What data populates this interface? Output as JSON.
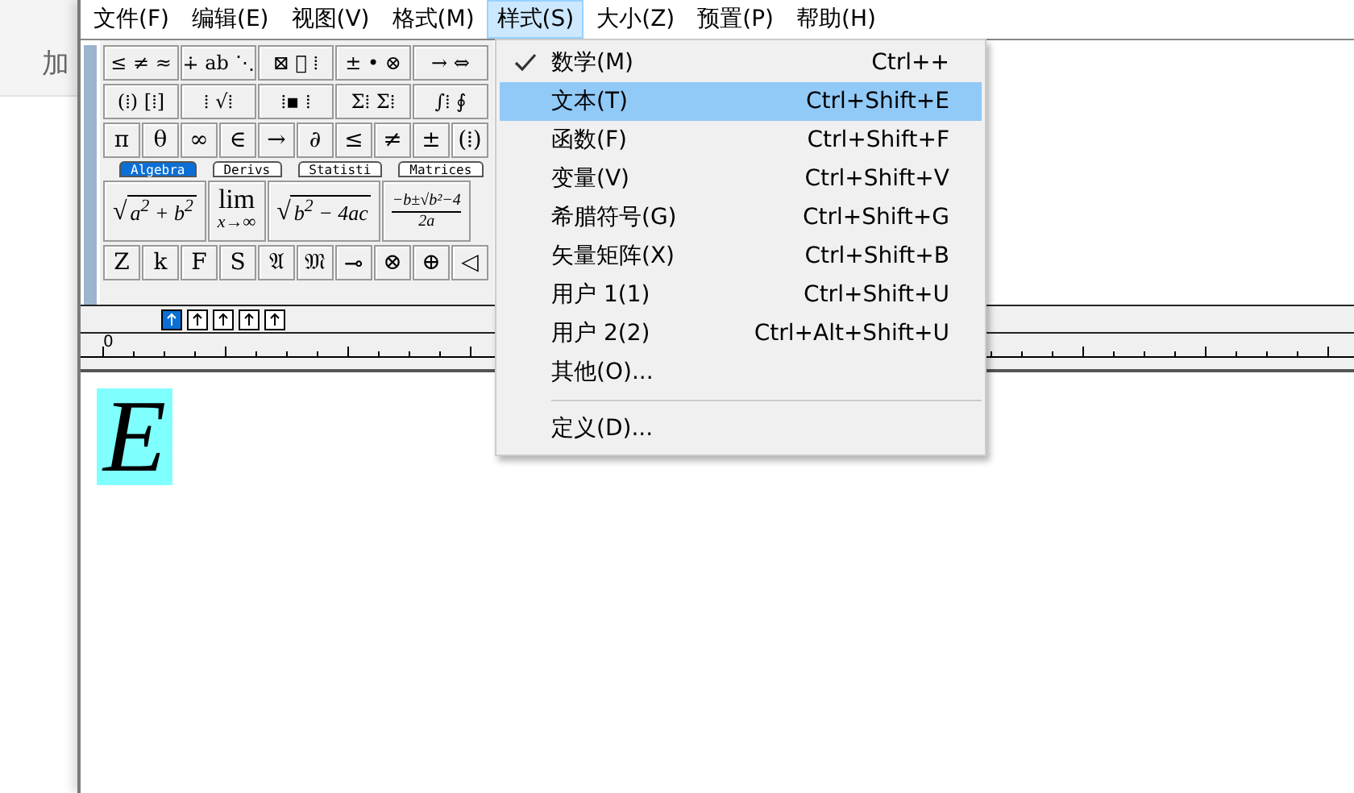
{
  "background_window": {
    "label": "加"
  },
  "menu_bar": [
    {
      "label": "文件(F)",
      "selected": false
    },
    {
      "label": "编辑(E)",
      "selected": false
    },
    {
      "label": "视图(V)",
      "selected": false
    },
    {
      "label": "格式(M)",
      "selected": false
    },
    {
      "label": "样式(S)",
      "selected": true
    },
    {
      "label": "大小(Z)",
      "selected": false
    },
    {
      "label": "预置(P)",
      "selected": false
    },
    {
      "label": "帮助(H)",
      "selected": false
    }
  ],
  "symbol_palettes": [
    [
      "≤ ≠ ≈",
      "∔ ab ⋱",
      "⊠ ⃗ ⁞",
      "± • ⊗",
      "→ ⇔"
    ],
    [
      "(⁞) [⁞]",
      "⁞ √⁞",
      "⁞▪ ⁞",
      "Σ⁞ Σ⁞",
      "∫⁞ ∮"
    ]
  ],
  "symbols": [
    "π",
    "θ",
    "∞",
    "∈",
    "→",
    "∂",
    "≤",
    "≠",
    "±",
    "(⁞)"
  ],
  "tabs": [
    {
      "label": "Algebra",
      "selected": true
    },
    {
      "label": "Derivs",
      "selected": false
    },
    {
      "label": "Statisti",
      "selected": false
    },
    {
      "label": "Matrices",
      "selected": false
    }
  ],
  "templates": [
    {
      "kind": "sqrt",
      "radical": "√",
      "body": "a$^{2}$ + b$^{2}$"
    },
    {
      "kind": "limit",
      "top": "lim",
      "bottom": "x→∞"
    },
    {
      "kind": "sqrt",
      "radical": "√",
      "body": "b$^{2}$ − 4ac"
    },
    {
      "kind": "fraction",
      "numerator": "−b±√b²−4",
      "denominator": "2a"
    }
  ],
  "style_symbols": [
    "Z",
    "k",
    "F",
    "S",
    "𝔄",
    "𝔐",
    "⊸",
    "⊗",
    "⊕",
    "◁"
  ],
  "nudge_buttons": [
    {
      "selected": true
    },
    {
      "selected": false
    },
    {
      "selected": false
    },
    {
      "selected": false
    },
    {
      "selected": false
    }
  ],
  "ruler": {
    "origin": "0"
  },
  "equation": {
    "text": "E",
    "selected": true
  },
  "style_menu": [
    {
      "kind": "item",
      "label": "数学(M)",
      "shortcut": "Ctrl++",
      "checked": true,
      "selected": false
    },
    {
      "kind": "item",
      "label": "文本(T)",
      "shortcut": "Ctrl+Shift+E",
      "checked": false,
      "selected": true
    },
    {
      "kind": "item",
      "label": "函数(F)",
      "shortcut": "Ctrl+Shift+F",
      "checked": false,
      "selected": false
    },
    {
      "kind": "item",
      "label": "变量(V)",
      "shortcut": "Ctrl+Shift+V",
      "checked": false,
      "selected": false
    },
    {
      "kind": "item",
      "label": "希腊符号(G)",
      "shortcut": "Ctrl+Shift+G",
      "checked": false,
      "selected": false
    },
    {
      "kind": "item",
      "label": "矢量矩阵(X)",
      "shortcut": "Ctrl+Shift+B",
      "checked": false,
      "selected": false
    },
    {
      "kind": "item",
      "label": "用户 1(1)",
      "shortcut": "Ctrl+Shift+U",
      "checked": false,
      "selected": false
    },
    {
      "kind": "item",
      "label": "用户 2(2)",
      "shortcut": "Ctrl+Alt+Shift+U",
      "checked": false,
      "selected": false
    },
    {
      "kind": "item",
      "label": "其他(O)...",
      "checked": false,
      "selected": false
    },
    {
      "kind": "separator"
    },
    {
      "kind": "item",
      "label": "定义(D)...",
      "checked": false,
      "selected": false
    }
  ]
}
